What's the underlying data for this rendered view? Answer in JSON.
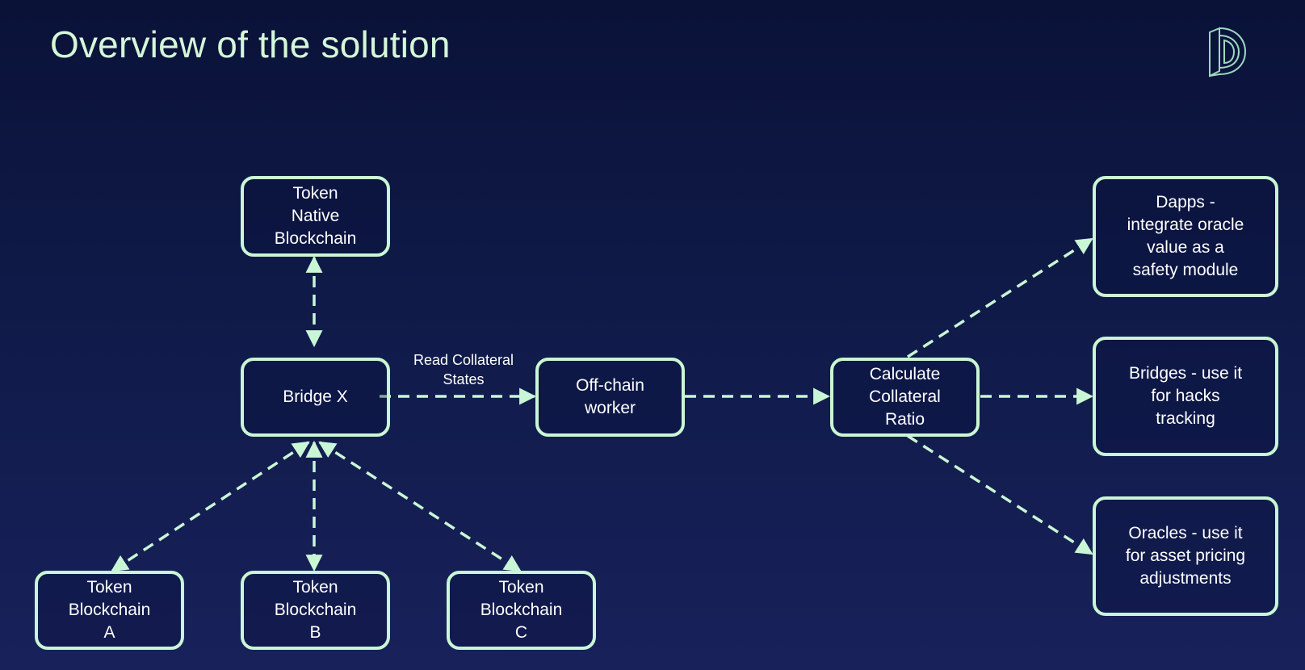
{
  "slide": {
    "title": "Overview of the solution",
    "logo_icon": "d-monogram-logo-icon"
  },
  "colors": {
    "accent": "#c9f7d5",
    "title": "#d4f7d8",
    "text": "#ffffff",
    "background_top": "#0a1238",
    "background_bottom": "#18215a"
  },
  "nodes": {
    "native": "Token\nNative\nBlockchain",
    "bridge_x": "Bridge X",
    "offchain": "Off-chain\nworker",
    "calc": "Calculate\nCollateral\nRatio",
    "dapps": "Dapps -\nintegrate oracle\nvalue as a\nsafety module",
    "bridges": "Bridges - use it\nfor hacks\ntracking",
    "oracles": "Oracles - use it\nfor asset pricing\nadjustments",
    "chain_a": "Token\nBlockchain\nA",
    "chain_b": "Token\nBlockchain\nB",
    "chain_c": "Token\nBlockchain\nC"
  },
  "edges": [
    {
      "from": "native",
      "to": "bridge_x",
      "style": "dashed",
      "arrows": "both"
    },
    {
      "from": "bridge_x",
      "to": "offchain",
      "style": "dashed",
      "arrows": "end",
      "label": "Read Collateral\nStates"
    },
    {
      "from": "offchain",
      "to": "calc",
      "style": "dashed",
      "arrows": "end"
    },
    {
      "from": "bridge_x",
      "to": "chain_a",
      "style": "dashed",
      "arrows": "both"
    },
    {
      "from": "bridge_x",
      "to": "chain_b",
      "style": "dashed",
      "arrows": "both"
    },
    {
      "from": "bridge_x",
      "to": "chain_c",
      "style": "dashed",
      "arrows": "both"
    },
    {
      "from": "calc",
      "to": "dapps",
      "style": "dashed",
      "arrows": "end"
    },
    {
      "from": "calc",
      "to": "bridges",
      "style": "dashed",
      "arrows": "end"
    },
    {
      "from": "calc",
      "to": "oracles",
      "style": "dashed",
      "arrows": "end"
    }
  ],
  "edge_labels": {
    "read_collateral": "Read Collateral\nStates"
  }
}
